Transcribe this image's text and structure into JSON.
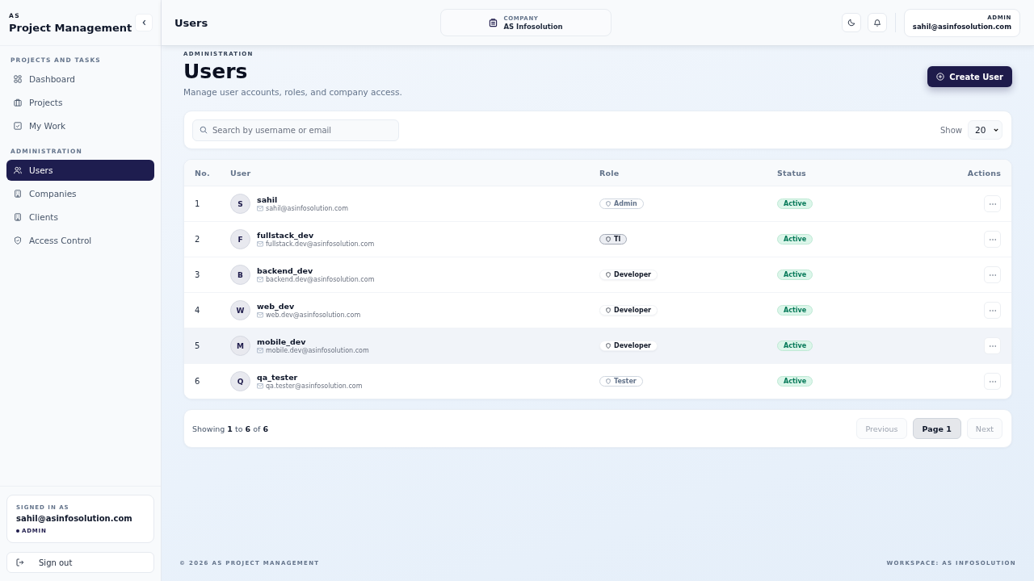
{
  "sidebar": {
    "brand_small": "AS",
    "brand": "Project Management",
    "sections": [
      {
        "heading": "PROJECTS AND TASKS",
        "items": [
          {
            "label": "Dashboard",
            "selected": false
          },
          {
            "label": "Projects",
            "selected": false
          },
          {
            "label": "My Work",
            "selected": false
          }
        ]
      },
      {
        "heading": "ADMINISTRATION",
        "items": [
          {
            "label": "Users",
            "selected": true
          },
          {
            "label": "Companies",
            "selected": false
          },
          {
            "label": "Clients",
            "selected": false
          },
          {
            "label": "Access Control",
            "selected": false
          }
        ]
      }
    ],
    "signed_in": {
      "label": "SIGNED IN AS",
      "email": "sahil@asinfosolution.com",
      "role": "ADMIN"
    },
    "sign_out": "Sign out"
  },
  "header": {
    "title": "Users",
    "company_label": "COMPANY",
    "company": "AS Infosolution",
    "user_role": "ADMIN",
    "user_email": "sahil@asinfosolution.com"
  },
  "page": {
    "eyebrow": "ADMINISTRATION",
    "title": "Users",
    "subtitle": "Manage user accounts, roles, and company access.",
    "create_button": "Create User"
  },
  "filters": {
    "search_placeholder": "Search by username or email",
    "show_label": "Show",
    "page_size": "20"
  },
  "table": {
    "columns": [
      "No.",
      "User",
      "Role",
      "Status",
      "Actions"
    ],
    "rows": [
      {
        "no": "1",
        "initial": "S",
        "username": "sahil",
        "email": "sahil@asinfosolution.com",
        "role": {
          "label": "Admin",
          "kind": "muted"
        },
        "status": "Active",
        "highlighted": false
      },
      {
        "no": "2",
        "initial": "F",
        "username": "fullstack_dev",
        "email": "fullstack.dev@asinfosolution.com",
        "role": {
          "label": "Tl",
          "kind": "filled"
        },
        "status": "Active",
        "highlighted": false
      },
      {
        "no": "3",
        "initial": "B",
        "username": "backend_dev",
        "email": "backend.dev@asinfosolution.com",
        "role": {
          "label": "Developer",
          "kind": "plain"
        },
        "status": "Active",
        "highlighted": false
      },
      {
        "no": "4",
        "initial": "W",
        "username": "web_dev",
        "email": "web.dev@asinfosolution.com",
        "role": {
          "label": "Developer",
          "kind": "plain"
        },
        "status": "Active",
        "highlighted": false
      },
      {
        "no": "5",
        "initial": "M",
        "username": "mobile_dev",
        "email": "mobile.dev@asinfosolution.com",
        "role": {
          "label": "Developer",
          "kind": "plain"
        },
        "status": "Active",
        "highlighted": true
      },
      {
        "no": "6",
        "initial": "Q",
        "username": "qa_tester",
        "email": "qa.tester@asinfosolution.com",
        "role": {
          "label": "Tester",
          "kind": "muted"
        },
        "status": "Active",
        "highlighted": false
      }
    ]
  },
  "pagination": {
    "summary": "Showing **1** to **6** of **6**",
    "previous": {
      "label": "Previous",
      "disabled": true
    },
    "current": "Page 1",
    "next": {
      "label": "Next",
      "disabled": true
    }
  },
  "footer": {
    "left": "© 2026 AS PROJECT MANAGEMENT",
    "right": "WORKSPACE: AS INFOSOLUTION"
  }
}
